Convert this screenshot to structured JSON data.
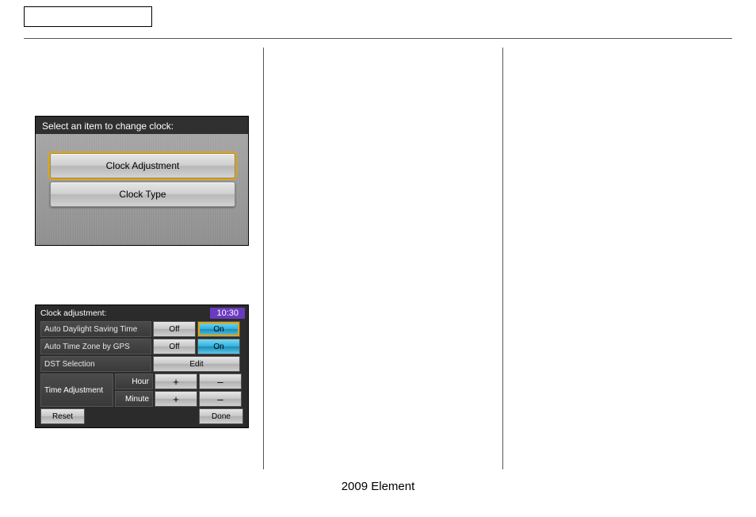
{
  "footer": {
    "label": "2009  Element"
  },
  "screen1": {
    "header": "Select an item to change clock:",
    "buttons": [
      {
        "label": "Clock Adjustment",
        "selected": true
      },
      {
        "label": "Clock Type",
        "selected": false
      }
    ]
  },
  "screen2": {
    "header": "Clock adjustment:",
    "time": "10:30",
    "rows": {
      "daylight": {
        "label": "Auto Daylight Saving Time",
        "off": "Off",
        "on": "On",
        "value": "On"
      },
      "timezone": {
        "label": "Auto Time Zone by GPS",
        "off": "Off",
        "on": "On",
        "value": "On"
      },
      "dst": {
        "label": "DST Selection",
        "edit": "Edit"
      }
    },
    "timeAdjust": {
      "label": "Time Adjustment",
      "hour": {
        "label": "Hour",
        "plus": "+",
        "minus": "–"
      },
      "minute": {
        "label": "Minute",
        "plus": "+",
        "minus": "–"
      }
    },
    "footer": {
      "reset": "Reset",
      "done": "Done"
    }
  }
}
